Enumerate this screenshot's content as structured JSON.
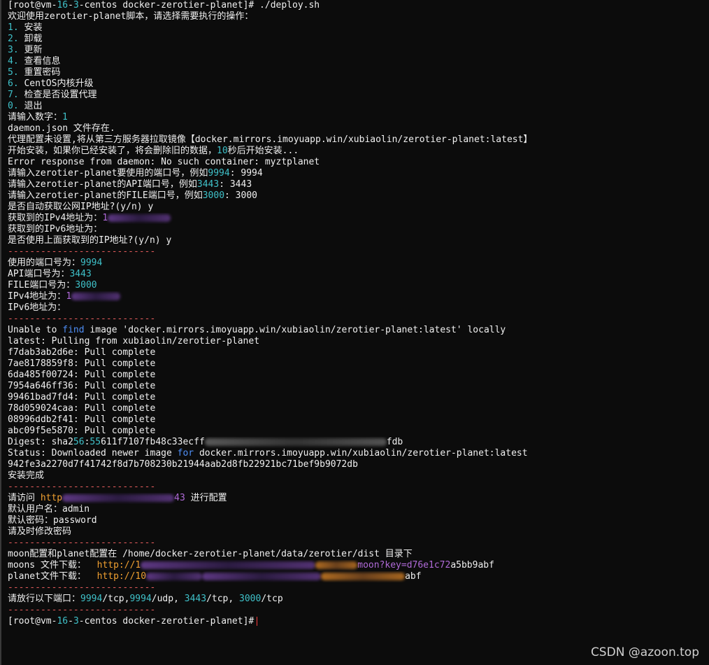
{
  "terminal": {
    "lines": [
      {
        "kind": "text",
        "segs": [
          {
            "t": "[root@vm-",
            "c": "white"
          },
          {
            "t": "16",
            "c": "cyan"
          },
          {
            "t": "-",
            "c": "white"
          },
          {
            "t": "3",
            "c": "cyan"
          },
          {
            "t": "-centos docker-zerotier-planet]# ./deploy.sh",
            "c": "white"
          }
        ]
      },
      {
        "kind": "text",
        "segs": [
          {
            "t": "欢迎使用zerotier-planet脚本，请选择需要执行的操作：",
            "c": "white"
          }
        ]
      },
      {
        "kind": "text",
        "segs": [
          {
            "t": "1. ",
            "c": "cyan"
          },
          {
            "t": "安装",
            "c": "white"
          }
        ]
      },
      {
        "kind": "text",
        "segs": [
          {
            "t": "2. ",
            "c": "cyan"
          },
          {
            "t": "卸载",
            "c": "white"
          }
        ]
      },
      {
        "kind": "text",
        "segs": [
          {
            "t": "3. ",
            "c": "cyan"
          },
          {
            "t": "更新",
            "c": "white"
          }
        ]
      },
      {
        "kind": "text",
        "segs": [
          {
            "t": "4. ",
            "c": "cyan"
          },
          {
            "t": "查看信息",
            "c": "white"
          }
        ]
      },
      {
        "kind": "text",
        "segs": [
          {
            "t": "5. ",
            "c": "cyan"
          },
          {
            "t": "重置密码",
            "c": "white"
          }
        ]
      },
      {
        "kind": "text",
        "segs": [
          {
            "t": "6. ",
            "c": "cyan"
          },
          {
            "t": "CentOS内核升级",
            "c": "white"
          }
        ]
      },
      {
        "kind": "text",
        "segs": [
          {
            "t": "7. ",
            "c": "cyan"
          },
          {
            "t": "检查是否设置代理",
            "c": "white"
          }
        ]
      },
      {
        "kind": "text",
        "segs": [
          {
            "t": "0. ",
            "c": "cyan"
          },
          {
            "t": "退出",
            "c": "white"
          }
        ]
      },
      {
        "kind": "text",
        "segs": [
          {
            "t": "请输入数字：",
            "c": "white"
          },
          {
            "t": "1",
            "c": "cyan"
          }
        ]
      },
      {
        "kind": "text",
        "segs": [
          {
            "t": "daemon.json 文件存在.",
            "c": "white"
          }
        ]
      },
      {
        "kind": "text",
        "segs": [
          {
            "t": "代理配置未设置,将从第三方服务器拉取镜像【docker.mirrors.imoyuapp.win/xubiaolin/zerotier-planet:latest】",
            "c": "white"
          }
        ]
      },
      {
        "kind": "text",
        "segs": [
          {
            "t": "开始安装，如果你已经安装了，将会删除旧的数据，",
            "c": "white"
          },
          {
            "t": "10",
            "c": "cyan"
          },
          {
            "t": "秒后开始安装...",
            "c": "white"
          }
        ]
      },
      {
        "kind": "text",
        "segs": [
          {
            "t": "Error response from daemon: No such container: myztplanet",
            "c": "white"
          }
        ]
      },
      {
        "kind": "text",
        "segs": [
          {
            "t": "请输入zerotier-planet要使用的端口号，例如",
            "c": "white"
          },
          {
            "t": "9994",
            "c": "cyan"
          },
          {
            "t": ": 9994",
            "c": "white"
          }
        ]
      },
      {
        "kind": "text",
        "segs": [
          {
            "t": "请输入zerotier-planet的API端口号，例如",
            "c": "white"
          },
          {
            "t": "3443",
            "c": "cyan"
          },
          {
            "t": ": 3443",
            "c": "white"
          }
        ]
      },
      {
        "kind": "text",
        "segs": [
          {
            "t": "请输入zerotier-planet的FILE端口号，例如",
            "c": "white"
          },
          {
            "t": "3000",
            "c": "cyan"
          },
          {
            "t": ": 3000",
            "c": "white"
          }
        ]
      },
      {
        "kind": "text",
        "segs": [
          {
            "t": "是否自动获取公网IP地址?(y/n) y",
            "c": "white"
          }
        ]
      },
      {
        "kind": "text",
        "segs": [
          {
            "t": "获取到的IPv4地址为：",
            "c": "white"
          },
          {
            "t": "1",
            "c": "purple"
          }
        ],
        "blur": [
          {
            "w": 90,
            "tone": "purple"
          }
        ]
      },
      {
        "kind": "text",
        "segs": [
          {
            "t": "获取到的IPv6地址为：",
            "c": "white"
          }
        ]
      },
      {
        "kind": "text",
        "segs": [
          {
            "t": "是否使用上面获取到的IP地址?(y/n) y",
            "c": "white"
          }
        ]
      },
      {
        "kind": "divider",
        "text": "---------------------------"
      },
      {
        "kind": "text",
        "segs": [
          {
            "t": "使用的端口号为：",
            "c": "white"
          },
          {
            "t": "9994",
            "c": "cyan"
          }
        ]
      },
      {
        "kind": "text",
        "segs": [
          {
            "t": "API端口号为：",
            "c": "white"
          },
          {
            "t": "3443",
            "c": "cyan"
          }
        ]
      },
      {
        "kind": "text",
        "segs": [
          {
            "t": "FILE端口号为：",
            "c": "white"
          },
          {
            "t": "3000",
            "c": "cyan"
          }
        ]
      },
      {
        "kind": "text",
        "segs": [
          {
            "t": "IPv4地址为：",
            "c": "white"
          },
          {
            "t": "1",
            "c": "purple"
          }
        ],
        "blur": [
          {
            "w": 70,
            "tone": "purple"
          }
        ]
      },
      {
        "kind": "text",
        "segs": [
          {
            "t": "IPv6地址为：",
            "c": "white"
          }
        ]
      },
      {
        "kind": "divider",
        "text": "---------------------------"
      },
      {
        "kind": "text",
        "segs": [
          {
            "t": "Unable to ",
            "c": "white"
          },
          {
            "t": "find",
            "c": "blue"
          },
          {
            "t": " image 'docker.mirrors.imoyuapp.win/xubiaolin/zerotier-planet:latest' locally",
            "c": "white"
          }
        ]
      },
      {
        "kind": "text",
        "segs": [
          {
            "t": "latest: Pulling from xubiaolin/zerotier-planet",
            "c": "white"
          }
        ]
      },
      {
        "kind": "text",
        "segs": [
          {
            "t": "f7dab3ab2d6e: Pull complete",
            "c": "white"
          }
        ]
      },
      {
        "kind": "text",
        "segs": [
          {
            "t": "7ae8178859f8: Pull complete",
            "c": "white"
          }
        ]
      },
      {
        "kind": "text",
        "segs": [
          {
            "t": "6da485f00724: Pull complete",
            "c": "white"
          }
        ]
      },
      {
        "kind": "text",
        "segs": [
          {
            "t": "7954a646ff36: Pull complete",
            "c": "white"
          }
        ]
      },
      {
        "kind": "text",
        "segs": [
          {
            "t": "99461bad7fd4: Pull complete",
            "c": "white"
          }
        ]
      },
      {
        "kind": "text",
        "segs": [
          {
            "t": "78d059024caa: Pull complete",
            "c": "white"
          }
        ]
      },
      {
        "kind": "text",
        "segs": [
          {
            "t": "08996ddb2f41: Pull complete",
            "c": "white"
          }
        ]
      },
      {
        "kind": "text",
        "segs": [
          {
            "t": "abc09f5e5870: Pull complete",
            "c": "white"
          }
        ]
      },
      {
        "kind": "text",
        "segs": [
          {
            "t": "Digest: sha2",
            "c": "white"
          },
          {
            "t": "56",
            "c": "cyan"
          },
          {
            "t": ":",
            "c": "white"
          },
          {
            "t": "55",
            "c": "cyan"
          },
          {
            "t": "611f7107fb48c33ecff",
            "c": "white"
          }
        ],
        "blur": [
          {
            "w": 260,
            "tone": "gray"
          }
        ],
        "tail": [
          {
            "t": "fdb",
            "c": "white"
          }
        ]
      },
      {
        "kind": "text",
        "segs": [
          {
            "t": "Status: Downloaded newer image ",
            "c": "white"
          },
          {
            "t": "for",
            "c": "blue"
          },
          {
            "t": " docker.mirrors.imoyuapp.win/xubiaolin/zerotier-planet:latest",
            "c": "white"
          }
        ]
      },
      {
        "kind": "text",
        "segs": [
          {
            "t": "942fe3a2270d7f41742f8d7b708230b21944aab2d8fb22921bc71bef9b9072db",
            "c": "white"
          }
        ]
      },
      {
        "kind": "text",
        "segs": [
          {
            "t": "安装完成",
            "c": "white"
          }
        ]
      },
      {
        "kind": "divider",
        "text": "---------------------------"
      },
      {
        "kind": "text",
        "segs": [
          {
            "t": "请访问 ",
            "c": "white"
          },
          {
            "t": "http",
            "c": "orange"
          }
        ],
        "blur": [
          {
            "w": 160,
            "tone": "purple"
          }
        ],
        "tail": [
          {
            "t": "43",
            "c": "purple"
          },
          {
            "t": " 进行配置",
            "c": "white"
          }
        ]
      },
      {
        "kind": "text",
        "segs": [
          {
            "t": "默认用户名：admin",
            "c": "white"
          }
        ]
      },
      {
        "kind": "text",
        "segs": [
          {
            "t": "默认密码：password",
            "c": "white"
          }
        ]
      },
      {
        "kind": "text",
        "segs": [
          {
            "t": "请及时修改密码",
            "c": "white"
          }
        ]
      },
      {
        "kind": "divider",
        "text": "---------------------------"
      },
      {
        "kind": "text",
        "segs": [
          {
            "t": "moon配置和planet配置在 /home/docker-zerotier-planet/data/zerotier/dist 目录下",
            "c": "white"
          }
        ]
      },
      {
        "kind": "text",
        "segs": [
          {
            "t": "moons 文件下载：  ",
            "c": "white"
          },
          {
            "t": "http://1",
            "c": "orange"
          }
        ],
        "blur": [
          {
            "w": 250,
            "tone": "purple"
          },
          {
            "w": 60,
            "tone": "orange"
          }
        ],
        "tail": [
          {
            "t": "moon?key=d76e1c72",
            "c": "purple"
          },
          {
            "t": "a5bb9abf",
            "c": "white"
          }
        ]
      },
      {
        "kind": "text",
        "segs": [
          {
            "t": "planet文件下载：  ",
            "c": "white"
          },
          {
            "t": "http://10",
            "c": "orange"
          }
        ],
        "blur": [
          {
            "w": 80,
            "tone": "purple"
          },
          {
            "w": 170,
            "tone": "purple"
          },
          {
            "w": 120,
            "tone": "orange"
          }
        ],
        "tail": [
          {
            "t": "abf",
            "c": "white"
          }
        ]
      },
      {
        "kind": "divider",
        "text": "---------------------------"
      },
      {
        "kind": "text",
        "segs": [
          {
            "t": "请放行以下端口：",
            "c": "white"
          },
          {
            "t": "9994",
            "c": "cyan"
          },
          {
            "t": "/tcp,",
            "c": "white"
          },
          {
            "t": "9994",
            "c": "cyan"
          },
          {
            "t": "/udp, ",
            "c": "white"
          },
          {
            "t": "3443",
            "c": "cyan"
          },
          {
            "t": "/tcp, ",
            "c": "white"
          },
          {
            "t": "3000",
            "c": "cyan"
          },
          {
            "t": "/tcp",
            "c": "white"
          }
        ]
      },
      {
        "kind": "divider",
        "text": "---------------------------"
      },
      {
        "kind": "prompt",
        "segs": [
          {
            "t": "[root@vm-",
            "c": "white"
          },
          {
            "t": "16",
            "c": "cyan"
          },
          {
            "t": "-",
            "c": "white"
          },
          {
            "t": "3",
            "c": "cyan"
          },
          {
            "t": "-centos docker-zerotier-planet]#",
            "c": "white"
          }
        ]
      }
    ]
  },
  "watermark": "CSDN @azoon.top"
}
